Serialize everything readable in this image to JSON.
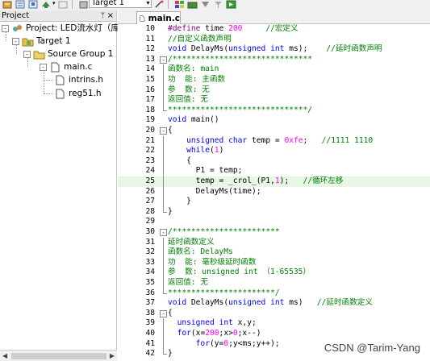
{
  "toolbar": {
    "target_label": "Target 1",
    "icons": [
      "rebuild-icon",
      "translate-icon",
      "batch-build-icon",
      "load-icon",
      "options-icon",
      "target-select",
      "options-wand-icon",
      "manage-components-icon",
      "pack-installer-icon",
      "select-packs-icon",
      "run-icon"
    ]
  },
  "project_panel": {
    "title": "Project",
    "pin": "ᛘ",
    "close": "×",
    "tree": [
      {
        "label": "Project: LED流水灯（库函",
        "icon": "project-icon",
        "level": 0,
        "expander": "-"
      },
      {
        "label": "Target 1",
        "icon": "target-folder-icon",
        "level": 1,
        "expander": "-"
      },
      {
        "label": "Source Group 1",
        "icon": "source-group-folder-icon",
        "level": 2,
        "expander": "-"
      },
      {
        "label": "main.c",
        "icon": "c-file-icon",
        "level": 3,
        "expander": "-"
      },
      {
        "label": "intrins.h",
        "icon": "h-file-icon",
        "level": 4,
        "expander": ""
      },
      {
        "label": "reg51.h",
        "icon": "h-file-icon",
        "level": 4,
        "expander": ""
      }
    ]
  },
  "editor": {
    "tab_label": "main.c",
    "highlight_line": 25,
    "lines": [
      {
        "n": "10",
        "code": "#define time 200     //宏定义"
      },
      {
        "n": "11",
        "code": "//自定义函数声明"
      },
      {
        "n": "12",
        "code": "void DelayMs(unsigned int ms);    //延时函数声明"
      },
      {
        "n": "13",
        "code": "/******************************"
      },
      {
        "n": "14",
        "code": "函数名: main"
      },
      {
        "n": "15",
        "code": "功  能: 主函数"
      },
      {
        "n": "16",
        "code": "参  数: 无"
      },
      {
        "n": "17",
        "code": "返回值: 无"
      },
      {
        "n": "18",
        "code": "******************************/"
      },
      {
        "n": "19",
        "code": "void main()"
      },
      {
        "n": "20",
        "code": "{"
      },
      {
        "n": "21",
        "code": "    unsigned char temp = 0xfe;   //1111 1110"
      },
      {
        "n": "22",
        "code": "    while(1)"
      },
      {
        "n": "23",
        "code": "    {"
      },
      {
        "n": "24",
        "code": "      P1 = temp;"
      },
      {
        "n": "25",
        "code": "      temp = _crol_(P1,1);   //循环左移"
      },
      {
        "n": "26",
        "code": "      DelayMs(time);"
      },
      {
        "n": "27",
        "code": "    }"
      },
      {
        "n": "28",
        "code": "}"
      },
      {
        "n": "29",
        "code": ""
      },
      {
        "n": "30",
        "code": "/***********************"
      },
      {
        "n": "31",
        "code": "延时函数定义"
      },
      {
        "n": "32",
        "code": "函数名: DelayMs"
      },
      {
        "n": "33",
        "code": "功  能: 毫秒级延时函数"
      },
      {
        "n": "34",
        "code": "参  数: unsigned int （1-65535）"
      },
      {
        "n": "35",
        "code": "返回值: 无"
      },
      {
        "n": "36",
        "code": "***********************/"
      },
      {
        "n": "37",
        "code": "void DelayMs(unsigned int ms)   //延时函数定义"
      },
      {
        "n": "38",
        "code": "{"
      },
      {
        "n": "39",
        "code": "  unsigned int x,y;"
      },
      {
        "n": "40",
        "code": "  for(x=200;x>0;x--)"
      },
      {
        "n": "41",
        "code": "      for(y=0;y<ms;y++);"
      },
      {
        "n": "42",
        "code": "}"
      }
    ]
  },
  "watermark": "CSDN @Tarim-Yang",
  "colors": {
    "keyword": "#0000ff",
    "comment": "#008000",
    "preprocessor": "#800080",
    "number": "#ff00ff",
    "highlight": "#e6f7e6"
  }
}
